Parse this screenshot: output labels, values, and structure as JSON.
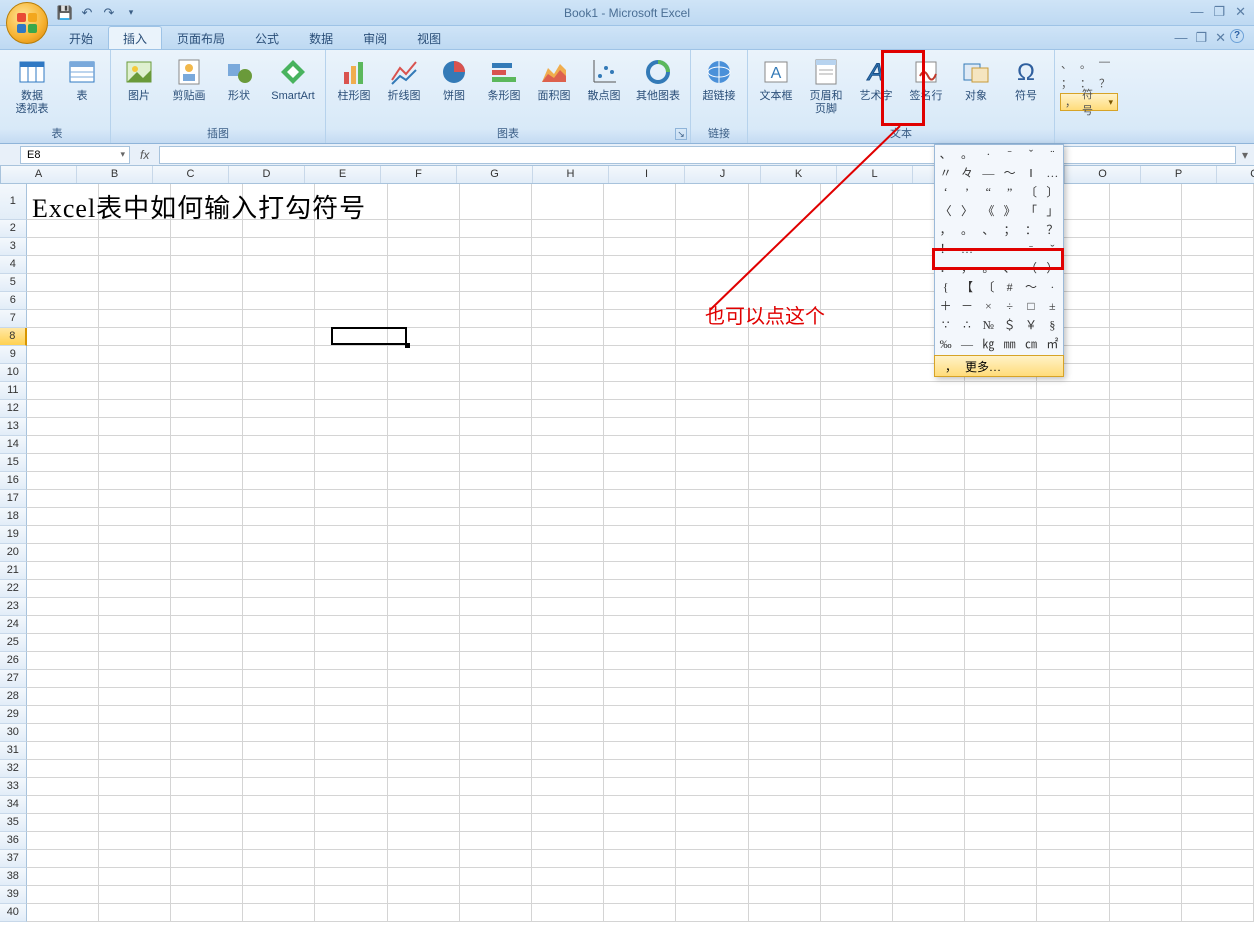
{
  "title": "Book1 - Microsoft Excel",
  "qat": {
    "save": "save",
    "undo": "undo",
    "redo": "redo"
  },
  "tabs": [
    "开始",
    "插入",
    "页面布局",
    "公式",
    "数据",
    "审阅",
    "视图"
  ],
  "active_tab_index": 1,
  "ribbon_groups": {
    "tables": {
      "label": "表",
      "items": [
        {
          "label": "数据\n透视表",
          "icon": "pivot"
        },
        {
          "label": "表",
          "icon": "table"
        }
      ]
    },
    "illus": {
      "label": "插图",
      "items": [
        {
          "label": "图片",
          "icon": "pic"
        },
        {
          "label": "剪贴画",
          "icon": "clip"
        },
        {
          "label": "形状",
          "icon": "shape"
        },
        {
          "label": "SmartArt",
          "icon": "smart"
        }
      ]
    },
    "charts": {
      "label": "图表",
      "items": [
        {
          "label": "柱形图",
          "icon": "col"
        },
        {
          "label": "折线图",
          "icon": "line"
        },
        {
          "label": "饼图",
          "icon": "pie"
        },
        {
          "label": "条形图",
          "icon": "bar"
        },
        {
          "label": "面积图",
          "icon": "area"
        },
        {
          "label": "散点图",
          "icon": "scat"
        },
        {
          "label": "其他图表",
          "icon": "other"
        }
      ]
    },
    "links": {
      "label": "链接",
      "items": [
        {
          "label": "超链接",
          "icon": "link"
        }
      ]
    },
    "text": {
      "label": "文本",
      "items": [
        {
          "label": "文本框",
          "icon": "tbox"
        },
        {
          "label": "页眉和\n页脚",
          "icon": "hdr"
        },
        {
          "label": "艺术字",
          "icon": "wart"
        },
        {
          "label": "签名行",
          "icon": "sig"
        },
        {
          "label": "对象",
          "icon": "obj"
        },
        {
          "label": "符号",
          "icon": "sym"
        }
      ]
    },
    "special": {
      "label": ""
    }
  },
  "name_box": "E8",
  "formula": "",
  "columns": [
    "A",
    "B",
    "C",
    "D",
    "E",
    "F",
    "G",
    "H",
    "I",
    "J",
    "K",
    "L",
    "M",
    "N",
    "O",
    "P",
    "Q"
  ],
  "row_count": 40,
  "selected_row": 8,
  "selected_col_index": 4,
  "cell_a1_text": "Excel表中如何输入打勾符号",
  "symbol_strip": {
    "glyph": "，",
    "label": "符号"
  },
  "symbol_grid": [
    "、",
    "。",
    "·",
    "ˉ",
    "ˇ",
    "¨",
    "〃",
    "々",
    "—",
    "～",
    "‖",
    "…",
    "‘",
    "’",
    "“",
    "”",
    "〔",
    "〕",
    "〈",
    "〉",
    "《",
    "》",
    "「",
    "」",
    "，",
    "。",
    "、",
    "；",
    "：",
    "？",
    "！",
    "…",
    "—",
    "·",
    "ˉ",
    "ˇ",
    "．",
    "，",
    "。",
    "、",
    "（",
    "）",
    "{",
    "【",
    "〔",
    "#",
    "～",
    "·",
    "＋",
    "－",
    "×",
    "÷",
    "□",
    "±",
    "∵",
    "∴",
    "№",
    "＄",
    "￥",
    "§",
    "‰",
    "—",
    "㎏",
    "㎜",
    "㎝",
    "㎡"
  ],
  "symbol_more": {
    "glyph": "，",
    "label": "更多…"
  },
  "annotation": "也可以点这个"
}
